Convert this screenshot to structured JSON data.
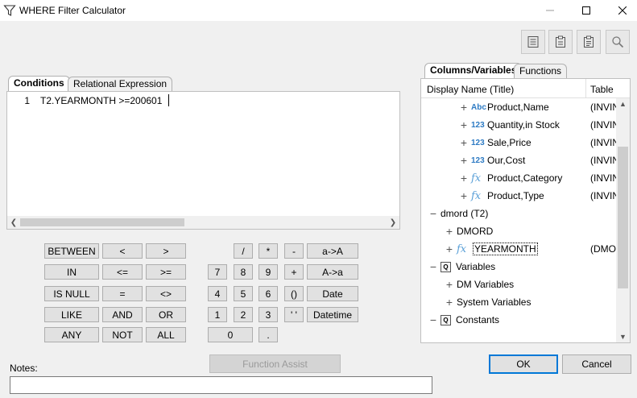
{
  "window": {
    "title": "WHERE Filter Calculator"
  },
  "left_tabs": [
    "Conditions",
    "Relational Expression"
  ],
  "editor": {
    "line_number": "1",
    "code": "T2.YEARMONTH >=200601"
  },
  "keypad": {
    "operators": [
      [
        "BETWEEN",
        "<",
        ">"
      ],
      [
        "IN",
        "<=",
        ">="
      ],
      [
        "IS NULL",
        "=",
        "<>"
      ],
      [
        "LIKE",
        "AND",
        "OR"
      ],
      [
        "ANY",
        "NOT",
        "ALL"
      ]
    ],
    "numpad": [
      [
        "",
        "",
        "/",
        "*",
        "-"
      ],
      [
        "7",
        "8",
        "9",
        "+",
        ""
      ],
      [
        "4",
        "5",
        "6",
        "()",
        ""
      ],
      [
        "1",
        "2",
        "3",
        "' '",
        ""
      ],
      [
        "0",
        ".",
        "",
        "",
        ""
      ]
    ],
    "side": [
      "a->A",
      "A->a",
      "Date",
      "Datetime"
    ],
    "function_assist": "Function Assist"
  },
  "notes": {
    "label": "Notes:",
    "value": ""
  },
  "right_tabs": [
    "Columns/Variables",
    "Functions"
  ],
  "tree": {
    "header_display": "Display Name (Title)",
    "header_table": "Table",
    "rows": [
      {
        "label": "Product,Name",
        "icon": "Abc",
        "table": "(INVIN"
      },
      {
        "label": "Quantity,in Stock",
        "icon": "123",
        "table": "(INVIN"
      },
      {
        "label": "Sale,Price",
        "icon": "123",
        "table": "(INVIN"
      },
      {
        "label": "Our,Cost",
        "icon": "123",
        "table": "(INVIN"
      },
      {
        "label": "Product,Category",
        "icon": "fx",
        "table": "(INVIN"
      },
      {
        "label": "Product,Type",
        "icon": "fx",
        "table": "(INVIN"
      },
      {
        "label": "dmord (T2)",
        "icon": "",
        "table": ""
      },
      {
        "label": "DMORD",
        "icon": "",
        "table": ""
      },
      {
        "label": "YEARMONTH",
        "icon": "fx",
        "table": "(DMO"
      },
      {
        "label": "Variables",
        "icon": "Q",
        "table": ""
      },
      {
        "label": "DM Variables",
        "icon": "",
        "table": ""
      },
      {
        "label": "System Variables",
        "icon": "",
        "table": ""
      },
      {
        "label": "Constants",
        "icon": "Q",
        "table": ""
      }
    ]
  },
  "footer": {
    "ok": "OK",
    "cancel": "Cancel"
  }
}
